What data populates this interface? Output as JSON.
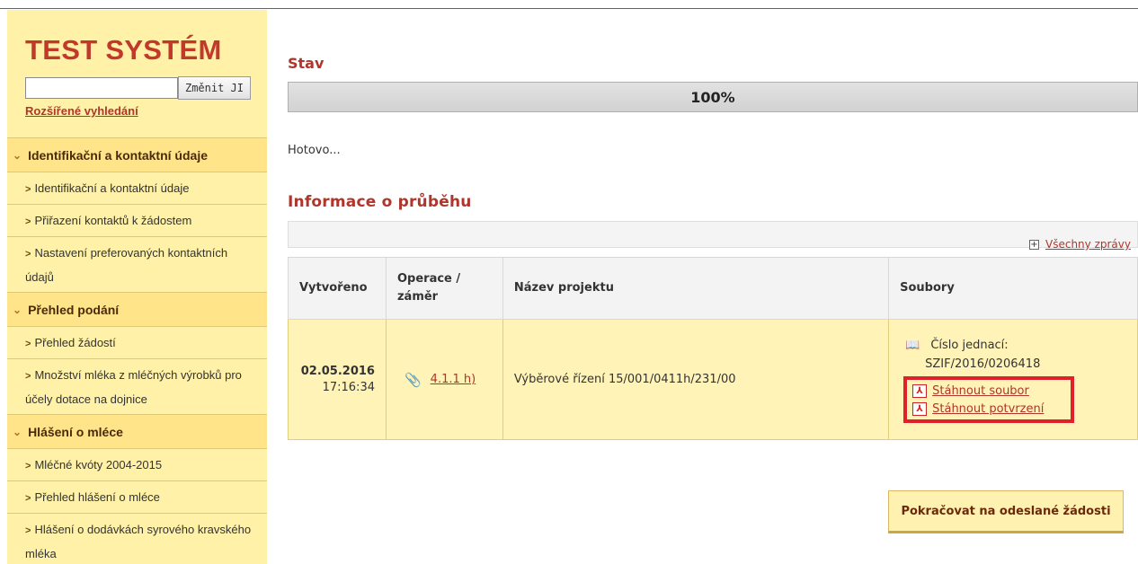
{
  "app": {
    "title": "TEST SYSTÉM"
  },
  "search": {
    "value": "",
    "placeholder": "",
    "button_label": "Změnit JI",
    "advanced_link": "Rozšířené vyhledání"
  },
  "sidebar": {
    "sections": [
      {
        "title": "Identifikační a kontaktní údaje",
        "items": [
          "Identifikační a kontaktní údaje",
          "Přiřazení kontaktů k žádostem",
          "Nastavení preferovaných kontaktních údajů"
        ]
      },
      {
        "title": "Přehled podání",
        "items": [
          "Přehled žádostí",
          "Množství mléka z mléčných výrobků pro účely dotace na dojnice"
        ]
      },
      {
        "title": "Hlášení o mléce",
        "items": [
          "Mléčné kvóty 2004-2015",
          "Přehled hlášení o mléce",
          "Hlášení o dodávkách syrového kravského mléka"
        ]
      }
    ]
  },
  "status": {
    "title": "Stav",
    "progress_percent": 100,
    "progress_label": "100%",
    "message": "Hotovo..."
  },
  "info": {
    "title": "Informace o průběhu",
    "all_messages_toggle": "+",
    "all_messages_link": "Všechny zprávy",
    "columns": [
      "Vytvořeno",
      "Operace / záměr",
      "Název projektu",
      "Soubory"
    ],
    "rows": [
      {
        "date": "02.05.2016",
        "time": "17:16:34",
        "operation": "4.1.1 h)",
        "project": "Výběrové řízení 15/001/0411h/231/00",
        "ref_label": "Číslo jednací:",
        "ref_value": "SZIF/2016/0206418",
        "download_file": "Stáhnout soubor",
        "download_confirmation": "Stáhnout potvrzení"
      }
    ]
  },
  "actions": {
    "continue_label": "Pokračovat na odeslané žádosti"
  },
  "colors": {
    "accent": "#b0352b",
    "sidebar_bg": "#fff1a8",
    "highlight_border": "#e0202a"
  }
}
